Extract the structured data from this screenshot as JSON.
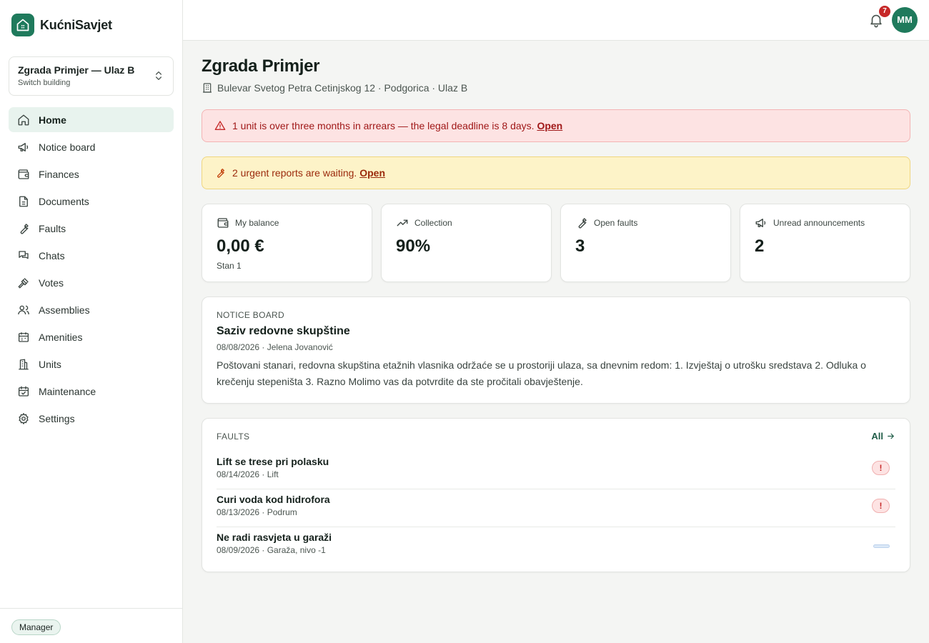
{
  "app": {
    "name": "KućniSavjet",
    "accent_color": "#1f7a5c"
  },
  "building_switcher": {
    "title": "Zgrada Primjer — Ulaz B",
    "subtitle": "Switch building"
  },
  "sidebar": {
    "items": [
      {
        "label": "Home",
        "icon": "home-icon"
      },
      {
        "label": "Notice board",
        "icon": "megaphone-icon"
      },
      {
        "label": "Finances",
        "icon": "wallet-icon"
      },
      {
        "label": "Documents",
        "icon": "document-icon"
      },
      {
        "label": "Faults",
        "icon": "wrench-icon"
      },
      {
        "label": "Chats",
        "icon": "chat-icon"
      },
      {
        "label": "Votes",
        "icon": "gavel-icon"
      },
      {
        "label": "Assemblies",
        "icon": "users-icon"
      },
      {
        "label": "Amenities",
        "icon": "calendar-icon"
      },
      {
        "label": "Units",
        "icon": "building-icon"
      },
      {
        "label": "Maintenance",
        "icon": "calendar-check-icon"
      },
      {
        "label": "Settings",
        "icon": "gear-icon"
      }
    ],
    "role": "Manager"
  },
  "topbar": {
    "notification_count": "7",
    "avatar_initials": "MM"
  },
  "page": {
    "title": "Zgrada Primjer",
    "address": "Bulevar Svetog Petra Cetinjskog 12 · Podgorica · Ulaz B"
  },
  "alerts": {
    "arrears": {
      "text": "1 unit is over three months in arrears — the legal deadline is 8 days.",
      "link": "Open",
      "color": "#a01818"
    },
    "urgent": {
      "text": "2 urgent reports are waiting.",
      "link": "Open",
      "color": "#9b2a0c"
    }
  },
  "stats": [
    {
      "label": "My balance",
      "value": "0,00 €",
      "sub": "Stan 1",
      "icon": "wallet-icon"
    },
    {
      "label": "Collection",
      "value": "90%",
      "sub": "",
      "icon": "trending-up-icon"
    },
    {
      "label": "Open faults",
      "value": "3",
      "sub": "",
      "icon": "wrench-icon"
    },
    {
      "label": "Unread announcements",
      "value": "2",
      "sub": "",
      "icon": "megaphone-icon"
    }
  ],
  "notice": {
    "section": "NOTICE BOARD",
    "title": "Saziv redovne skupštine",
    "meta": "08/08/2026 · Jelena Jovanović",
    "body": "Poštovani stanari, redovna skupština etažnih vlasnika održaće se u prostoriji ulaza, sa dnevnim redom: 1. Izvještaj o utrošku sredstava 2. Odluka o krečenju stepeništa 3. Razno Molimo vas da potvrdite da ste pročitali obavještenje."
  },
  "faults": {
    "section": "FAULTS",
    "all_label": "All",
    "items": [
      {
        "title": "Lift se trese pri polasku",
        "meta": "08/14/2026 · Lift",
        "priority_mark": "!"
      },
      {
        "title": "Curi voda kod hidrofora",
        "meta": "08/13/2026 · Podrum",
        "priority_mark": "!"
      },
      {
        "title": "Ne radi rasvjeta u garaži",
        "meta": "08/09/2026 · Garaža, nivo -1",
        "priority_mark": ""
      }
    ]
  }
}
